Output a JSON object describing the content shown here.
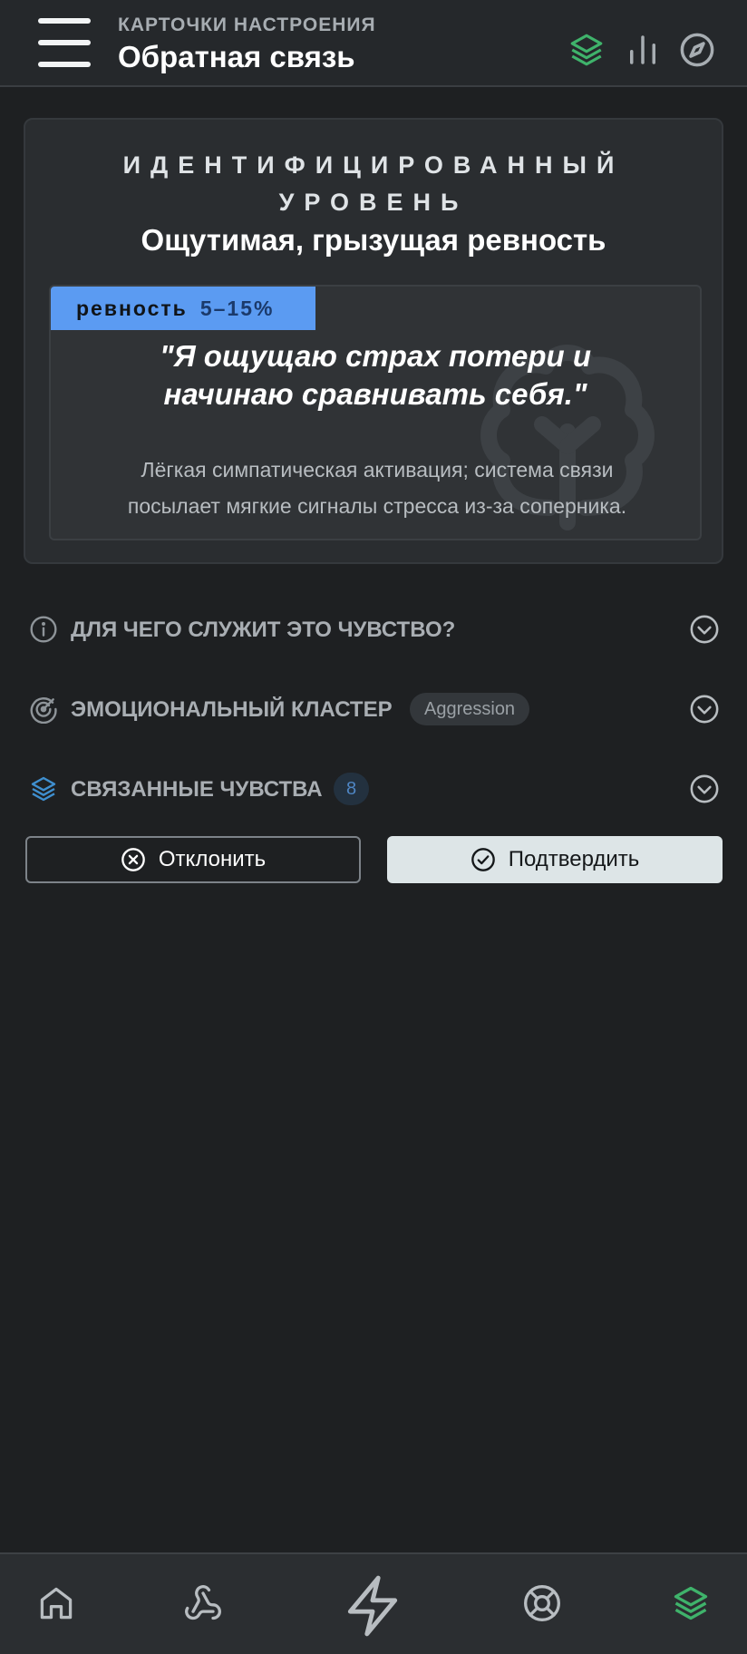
{
  "header": {
    "subtitle": "КАРТОЧКИ НАСТРОЕНИЯ",
    "title": "Обратная связь",
    "icons": [
      "menu-icon",
      "layers-icon",
      "bar-chart-icon",
      "compass-icon"
    ],
    "active_color": "#3fb36b"
  },
  "card": {
    "kicker": "ИДЕНТИФИЦИРОВАННЫЙ УРОВЕНЬ",
    "title": "Ощутимая, грызущая ревность",
    "badge_name": "ревность",
    "badge_range": "5–15%",
    "badge_color": "#5b9bf2",
    "quote_line1": "\"Я ощущаю страх потери и",
    "quote_line2": "начинаю сравнивать себя.\"",
    "description_line1": "Лёгкая симпатическая активация; система связи",
    "description_line2": "посылает мягкие сигналы стресса из-за соперника.",
    "watermark_icon": "tree-icon"
  },
  "sections": {
    "purpose": "ДЛЯ ЧЕГО СЛУЖИТ ЭТО ЧУВСТВО?",
    "cluster": "ЭМОЦИОНАЛЬНЫЙ КЛАСТЕР",
    "cluster_value": "Aggression",
    "related": "СВЯЗАННЫЕ ЧУВСТВА",
    "related_count": "8"
  },
  "actions": {
    "reject": "Отклонить",
    "confirm": "Подтвердить"
  },
  "bottom_nav": {
    "items": [
      "home-icon",
      "webhook-icon",
      "lightning-icon",
      "lifebuoy-icon",
      "layers-icon"
    ],
    "active": "layers-icon"
  }
}
